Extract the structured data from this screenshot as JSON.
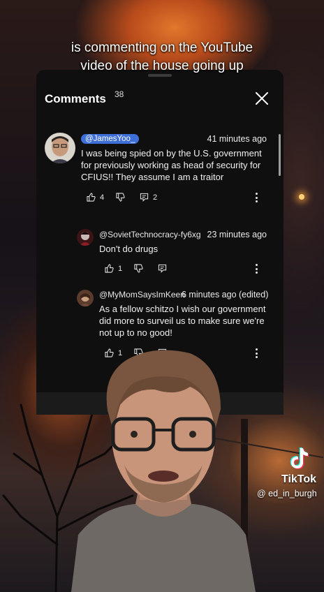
{
  "caption": {
    "line1": "is commenting on the YouTube",
    "line2": "video of the house going up"
  },
  "panel": {
    "title": "Comments",
    "count": "38"
  },
  "comments": [
    {
      "author": "@JamesYoo_",
      "time": "41 minutes ago",
      "text": "I was being spied on by the U.S. government for previously working as head of security for CFIUS!! They assume I am a traitor",
      "likes": "4",
      "replies": "2"
    },
    {
      "author": "@SovietTechnocracy-fy6xg",
      "time": "23 minutes ago",
      "text": "Don't do drugs",
      "likes": "1",
      "replies": ""
    },
    {
      "author": "@MyMomSaysImKeen",
      "time": "6 minutes ago (edited)",
      "text": "As a fellow schitzo I wish our government did more to surveil us to make sure we're not up to no good!",
      "likes": "1",
      "replies": ""
    }
  ],
  "tiktok": {
    "brand": "TikTok",
    "username": "@ ed_in_burgh"
  },
  "colors": {
    "panel_bg": "#0f0f0f",
    "author_chip": "#3e6ed8",
    "text": "#f0f0f0"
  }
}
